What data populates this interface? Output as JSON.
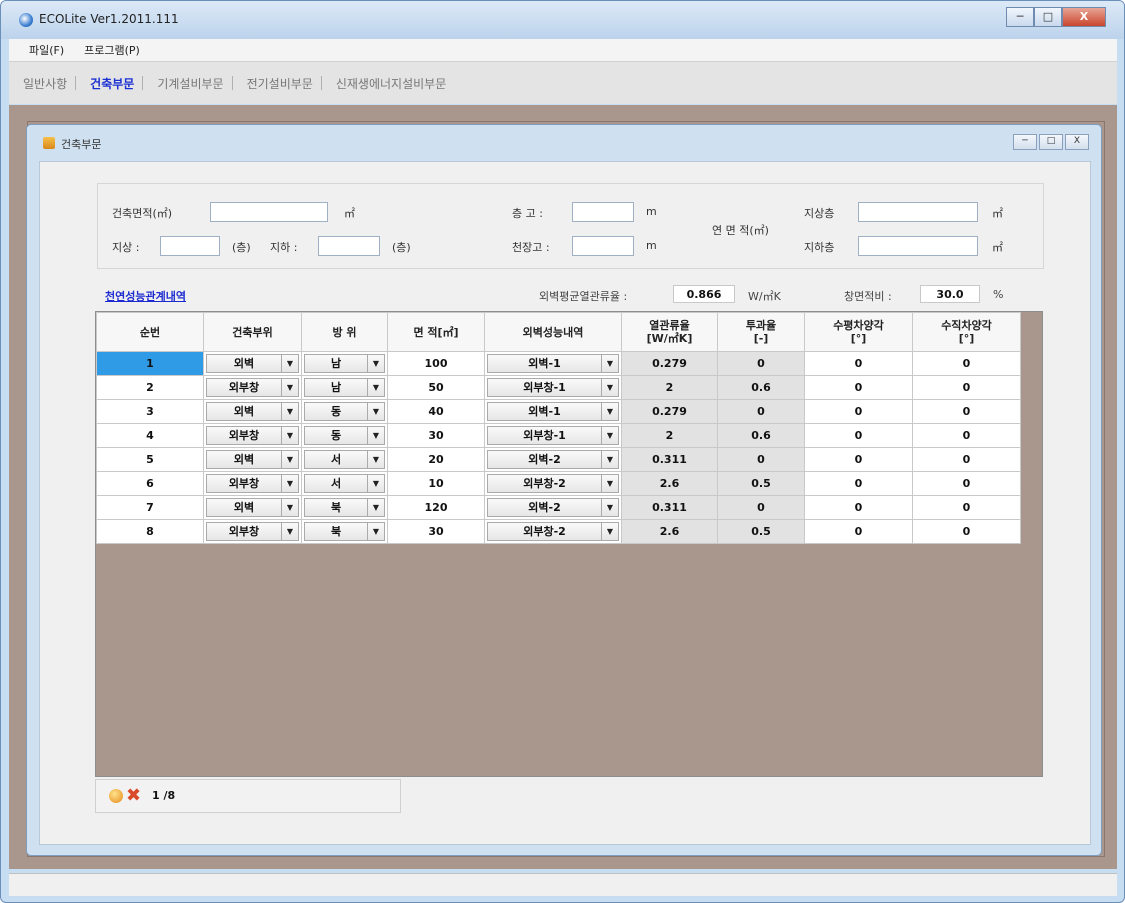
{
  "window": {
    "title": "ECOLite Ver1.2011.111",
    "controls": [
      "─",
      "□",
      "X"
    ]
  },
  "menu": [
    {
      "label": "파일(F)"
    },
    {
      "label": "프로그램(P)"
    }
  ],
  "nav_tabs": [
    {
      "label": "일반사항"
    },
    {
      "label": "건축부문"
    },
    {
      "label": "기계설비부문"
    },
    {
      "label": "전기설비부문"
    },
    {
      "label": "신재생에너지설비부문"
    }
  ],
  "active_tab": "건축부문",
  "child_window": {
    "title": "건축부문",
    "controls": [
      "─",
      "□",
      "X"
    ]
  },
  "form": {
    "building_area_label": "건축면적(㎡)",
    "building_area_value": "",
    "building_area_unit": "㎡",
    "above_floors_label": "지상 :",
    "above_floors_value": "",
    "floors_unit": "(층)",
    "below_floors_label": "지하 :",
    "below_floors_value": "",
    "floor_height_label": "층 고 :",
    "floor_height_value": "",
    "ceiling_height_label": "천장고 :",
    "ceiling_height_value": "",
    "height_unit": "m",
    "gross_area_label": "연 면 적(㎡)",
    "above_ground_label": "지상층",
    "above_ground_value": "",
    "below_ground_label": "지하층",
    "below_ground_value": "",
    "area_unit": "㎡"
  },
  "summary": {
    "link": "천연성능관계내역",
    "avg_u_label": "외벽평균열관류율 :",
    "avg_u_value": "0.866",
    "avg_u_unit": "W/㎡K",
    "window_ratio_label": "창면적비 :",
    "window_ratio_value": "30.0",
    "window_ratio_unit": "%"
  },
  "grid": {
    "columns": [
      "순번",
      "건축부위",
      "방 위",
      "면 적[㎡]",
      "외벽성능내역",
      "열관류율\n[W/㎡K]",
      "투과율\n[-]",
      "수평차양각\n[°]",
      "수직차양각\n[°]"
    ],
    "rows": [
      {
        "no": "1",
        "part": "외벽",
        "dir": "남",
        "area": "100",
        "spec": "외벽-1",
        "u": "0.279",
        "trans": "0",
        "h_angle": "0",
        "v_angle": "0"
      },
      {
        "no": "2",
        "part": "외부창",
        "dir": "남",
        "area": "50",
        "spec": "외부창-1",
        "u": "2",
        "trans": "0.6",
        "h_angle": "0",
        "v_angle": "0"
      },
      {
        "no": "3",
        "part": "외벽",
        "dir": "동",
        "area": "40",
        "spec": "외벽-1",
        "u": "0.279",
        "trans": "0",
        "h_angle": "0",
        "v_angle": "0"
      },
      {
        "no": "4",
        "part": "외부창",
        "dir": "동",
        "area": "30",
        "spec": "외부창-1",
        "u": "2",
        "trans": "0.6",
        "h_angle": "0",
        "v_angle": "0"
      },
      {
        "no": "5",
        "part": "외벽",
        "dir": "서",
        "area": "20",
        "spec": "외벽-2",
        "u": "0.311",
        "trans": "0",
        "h_angle": "0",
        "v_angle": "0"
      },
      {
        "no": "6",
        "part": "외부창",
        "dir": "서",
        "area": "10",
        "spec": "외부창-2",
        "u": "2.6",
        "trans": "0.5",
        "h_angle": "0",
        "v_angle": "0"
      },
      {
        "no": "7",
        "part": "외벽",
        "dir": "북",
        "area": "120",
        "spec": "외벽-2",
        "u": "0.311",
        "trans": "0",
        "h_angle": "0",
        "v_angle": "0"
      },
      {
        "no": "8",
        "part": "외부창",
        "dir": "북",
        "area": "30",
        "spec": "외부창-2",
        "u": "2.6",
        "trans": "0.5",
        "h_angle": "0",
        "v_angle": "0"
      }
    ]
  },
  "navigator": {
    "position": "1",
    "total": "/8"
  }
}
